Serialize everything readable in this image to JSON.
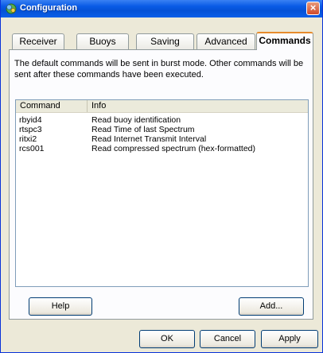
{
  "window": {
    "title": "Configuration"
  },
  "tabs": [
    {
      "label": "Receiver"
    },
    {
      "label": "Buoys"
    },
    {
      "label": "Saving"
    },
    {
      "label": "Advanced"
    },
    {
      "label": "Commands",
      "active": true
    }
  ],
  "description": "The default commands will be sent in burst mode. Other commands will be sent after these commands have been executed.",
  "list": {
    "columns": [
      "Command",
      "Info"
    ],
    "rows": [
      {
        "command": "rbyid4",
        "info": "Read buoy identification"
      },
      {
        "command": "rtspc3",
        "info": "Read Time of last Spectrum"
      },
      {
        "command": "ritxi2",
        "info": "Read Internet Transmit Interval"
      },
      {
        "command": "rcs001",
        "info": "Read compressed spectrum (hex-formatted)"
      }
    ]
  },
  "panel_buttons": {
    "help": "Help",
    "add": "Add..."
  },
  "dialog_buttons": {
    "ok": "OK",
    "cancel": "Cancel",
    "apply": "Apply"
  },
  "icons": {
    "app": "gear-icon",
    "close": "close-icon"
  },
  "colors": {
    "titlebar": "#0a5be6",
    "active_tab_accent": "#e68b2c",
    "face": "#ece9d8"
  }
}
